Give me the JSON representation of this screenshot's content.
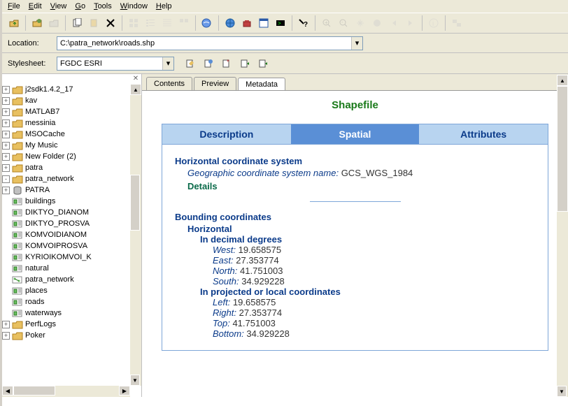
{
  "menu": {
    "file": "File",
    "edit": "Edit",
    "view": "View",
    "go": "Go",
    "tools": "Tools",
    "window": "Window",
    "help": "Help"
  },
  "loc": {
    "label": "Location:",
    "value": "C:\\patra_network\\roads.shp"
  },
  "sty": {
    "label": "Stylesheet:",
    "value": "FGDC ESRI"
  },
  "tree": [
    {
      "d": 0,
      "t": "+",
      "ico": "folder",
      "label": "j2sdk1.4.2_17"
    },
    {
      "d": 0,
      "t": "+",
      "ico": "folder",
      "label": "kav"
    },
    {
      "d": 0,
      "t": "+",
      "ico": "folder",
      "label": "MATLAB7"
    },
    {
      "d": 0,
      "t": "+",
      "ico": "folder",
      "label": "messinia"
    },
    {
      "d": 0,
      "t": "+",
      "ico": "folder",
      "label": "MSOCache"
    },
    {
      "d": 0,
      "t": "+",
      "ico": "folder",
      "label": "My Music"
    },
    {
      "d": 0,
      "t": "+",
      "ico": "folder",
      "label": "New Folder (2)"
    },
    {
      "d": 0,
      "t": "+",
      "ico": "folder",
      "label": "patra"
    },
    {
      "d": 0,
      "t": "-",
      "ico": "folder",
      "label": "patra_network"
    },
    {
      "d": 1,
      "t": "+",
      "ico": "db",
      "label": "PATRA"
    },
    {
      "d": 1,
      "t": "",
      "ico": "fc",
      "label": "buildings"
    },
    {
      "d": 1,
      "t": "",
      "ico": "fc",
      "label": "DIKTYO_DIANOM"
    },
    {
      "d": 1,
      "t": "",
      "ico": "fc",
      "label": "DIKTYO_PROSVA"
    },
    {
      "d": 1,
      "t": "",
      "ico": "fc",
      "label": "KOMVOIDIANOM"
    },
    {
      "d": 1,
      "t": "",
      "ico": "fc",
      "label": "KOMVOIPROSVA"
    },
    {
      "d": 1,
      "t": "",
      "ico": "fc",
      "label": "KYRIOIKOMVOI_K"
    },
    {
      "d": 1,
      "t": "",
      "ico": "fc",
      "label": "natural"
    },
    {
      "d": 1,
      "t": "",
      "ico": "net",
      "label": "patra_network"
    },
    {
      "d": 1,
      "t": "",
      "ico": "fc",
      "label": "places"
    },
    {
      "d": 1,
      "t": "",
      "ico": "fc",
      "label": "roads"
    },
    {
      "d": 1,
      "t": "",
      "ico": "fc",
      "label": "waterways"
    },
    {
      "d": 0,
      "t": "+",
      "ico": "folder",
      "label": "PerfLogs"
    },
    {
      "d": 0,
      "t": "+",
      "ico": "folder",
      "label": "Poker"
    }
  ],
  "ctabs": {
    "contents": "Contents",
    "preview": "Preview",
    "metadata": "Metadata"
  },
  "page": {
    "title": "Shapefile",
    "mtabs": {
      "desc": "Description",
      "spa": "Spatial",
      "attr": "Attributes"
    },
    "hcs": {
      "heading": "Horizontal coordinate system",
      "label": "Geographic coordinate system name:",
      "value": "GCS_WGS_1984",
      "details": "Details"
    },
    "bc": {
      "heading": "Bounding coordinates",
      "horiz": "Horizontal",
      "dec": "In decimal degrees",
      "west_l": "West:",
      "west_v": "19.658575",
      "east_l": "East:",
      "east_v": "27.353774",
      "north_l": "North:",
      "north_v": "41.751003",
      "south_l": "South:",
      "south_v": "34.929228",
      "proj": "In projected or local coordinates",
      "left_l": "Left:",
      "left_v": "19.658575",
      "right_l": "Right:",
      "right_v": "27.353774",
      "top_l": "Top:",
      "top_v": "41.751003",
      "bottom_l": "Bottom:",
      "bottom_v": "34.929228"
    }
  }
}
